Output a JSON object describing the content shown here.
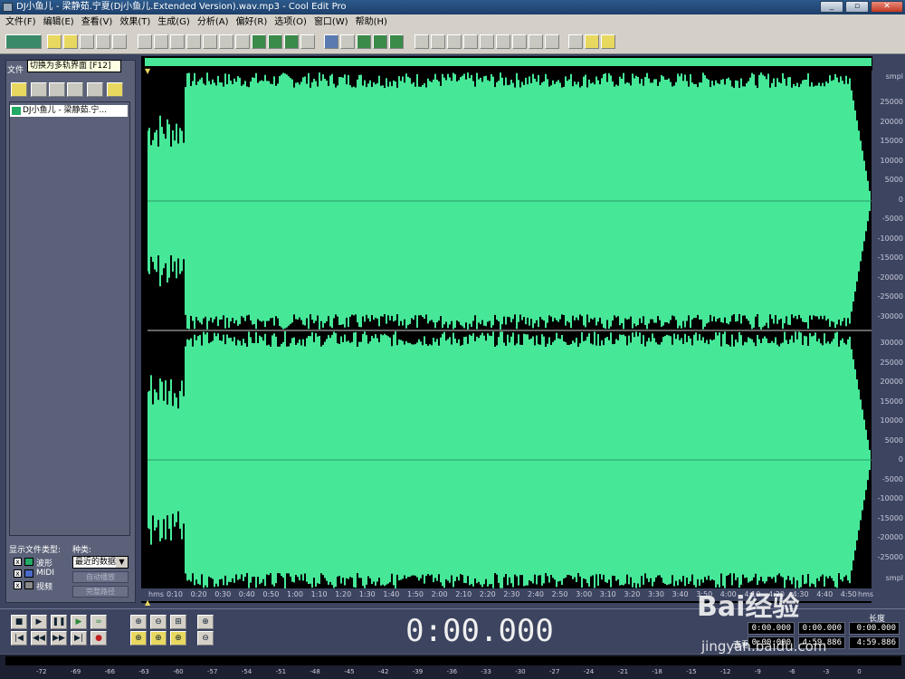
{
  "window": {
    "title": "DJ小鱼儿 - 梁静茹.宁夏(Dj小鱼儿.Extended Version).wav.mp3 - Cool Edit Pro"
  },
  "menu": [
    "文件(F)",
    "编辑(E)",
    "查看(V)",
    "效果(T)",
    "生成(G)",
    "分析(A)",
    "偏好(R)",
    "选项(O)",
    "窗口(W)",
    "帮助(H)"
  ],
  "tooltip": "切换为多轨界面  [F12]",
  "panel": {
    "tab_label": "文件",
    "file_item": "DJ小鱼儿 - 梁静茹.宁...",
    "file_type_label": "显示文件类型:",
    "kind_label": "种类:",
    "types": [
      "波形",
      "MIDI",
      "视频"
    ],
    "kind_value": "最近的数据",
    "btn_autoplay": "自动播放",
    "btn_fullpath": "完整路径"
  },
  "ruler_right": {
    "unit": "smpl",
    "top_ticks": [
      "25000",
      "20000",
      "15000",
      "10000",
      "5000",
      "0",
      "-5000",
      "-10000",
      "-15000",
      "-20000",
      "-25000",
      "-30000"
    ],
    "bottom_ticks": [
      "30000",
      "25000",
      "20000",
      "15000",
      "10000",
      "5000",
      "0",
      "-5000",
      "-10000",
      "-15000",
      "-20000",
      "-25000"
    ],
    "bottom_unit": "smpl"
  },
  "timeline": {
    "unit_left": "hms",
    "unit_right": "hms",
    "ticks": [
      "0:10",
      "0:20",
      "0:30",
      "0:40",
      "0:50",
      "1:00",
      "1:10",
      "1:20",
      "1:30",
      "1:40",
      "1:50",
      "2:00",
      "2:10",
      "2:20",
      "2:30",
      "2:40",
      "2:50",
      "3:00",
      "3:10",
      "3:20",
      "3:30",
      "3:40",
      "3:50",
      "4:00",
      "4:10",
      "4:20",
      "4:30",
      "4:40",
      "4:50"
    ]
  },
  "transport": {
    "time": "0:00.000"
  },
  "info": {
    "length_label": "长度",
    "view_label": "查看",
    "sel_begin": "0:00.000",
    "sel_end": "0:00.000",
    "view_begin": "0:00.000",
    "view_end": "4:59.886",
    "view_len": "4:59.886",
    "sel_len": "0:00.000"
  },
  "meter_ticks": [
    "-72",
    "-69",
    "-66",
    "-63",
    "-60",
    "-57",
    "-54",
    "-51",
    "-48",
    "-45",
    "-42",
    "-39",
    "-36",
    "-33",
    "-30",
    "-27",
    "-24",
    "-21",
    "-18",
    "-15",
    "-12",
    "-9",
    "-6",
    "-3",
    "0"
  ],
  "watermark": {
    "brand": "Bai经验",
    "url": "jingyan.baidu.com"
  },
  "colors": {
    "waveform": "#46e898",
    "background": "#000000"
  }
}
